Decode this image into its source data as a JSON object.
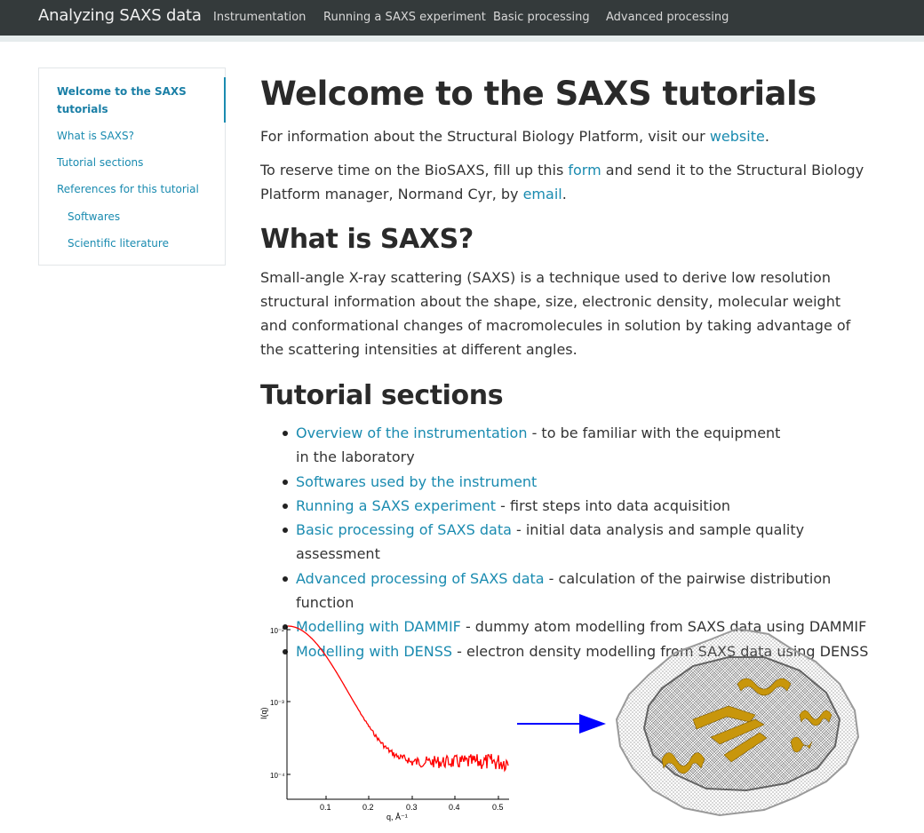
{
  "navbar": {
    "brand": "Analyzing SAXS data",
    "items": [
      "Instrumentation",
      "Running a SAXS experiment",
      "Basic processing",
      "Advanced processing"
    ]
  },
  "toc": {
    "items": [
      {
        "label": "Welcome to the SAXS tutorials",
        "active": true,
        "level": 1
      },
      {
        "label": "What is SAXS?",
        "active": false,
        "level": 1
      },
      {
        "label": "Tutorial sections",
        "active": false,
        "level": 1
      },
      {
        "label": "References for this tutorial",
        "active": false,
        "level": 1
      },
      {
        "label": "Softwares",
        "active": false,
        "level": 2
      },
      {
        "label": "Scientific literature",
        "active": false,
        "level": 2
      }
    ]
  },
  "main": {
    "title": "Welcome to the SAXS tutorials",
    "intro1": {
      "before": "For information about the Structural Biology Platform, visit our ",
      "link": "website",
      "after": "."
    },
    "intro2": {
      "before": "To reserve time on the BioSAXS, fill up this ",
      "link1": "form",
      "middle": " and send it to the Structural Biology Platform manager, Normand Cyr, by ",
      "link2": "email",
      "after": "."
    },
    "what_heading": "What is SAXS?",
    "what_text": "Small-angle X-ray scattering (SAXS) is a technique used to derive low resolution structural information about the shape, size, electronic density, molecular weight and conformational changes of macromolecules in solution by taking advantage of the scattering intensities at different angles.",
    "sections_heading": "Tutorial sections",
    "sections": [
      {
        "link": "Overview of the instrumentation",
        "desc": " - to be familiar with the equipment in the laboratory"
      },
      {
        "link": "Softwares used by the instrument",
        "desc": ""
      },
      {
        "link": "Running a SAXS experiment",
        "desc": " - first steps into data acquisition"
      },
      {
        "link": "Basic processing of SAXS data",
        "desc": " - initial data analysis and sample quality assessment"
      },
      {
        "link": "Advanced processing of SAXS data",
        "desc": " - calculation of the pairwise distribution function"
      },
      {
        "link": "Modelling with DAMMIF",
        "desc": " - dummy atom modelling from SAXS data using DAMMIF"
      },
      {
        "link": "Modelling with DENSS",
        "desc": " - electron density modelling from SAXS data using DENSS"
      }
    ]
  },
  "figure": {
    "plot": {
      "ylabel": "I(q)",
      "xlabel": "q, Å⁻¹",
      "yticks": [
        "10⁻²",
        "10⁻³",
        "10⁻⁴"
      ],
      "xticks": [
        "0.1",
        "0.2",
        "0.3",
        "0.4",
        "0.5"
      ],
      "curve_color": "#ff0000"
    },
    "arrow_color": "#0000ff",
    "protein_color": "#c8960c"
  },
  "colors": {
    "navbar_bg": "#343a3b",
    "link": "#1a8bb0"
  }
}
